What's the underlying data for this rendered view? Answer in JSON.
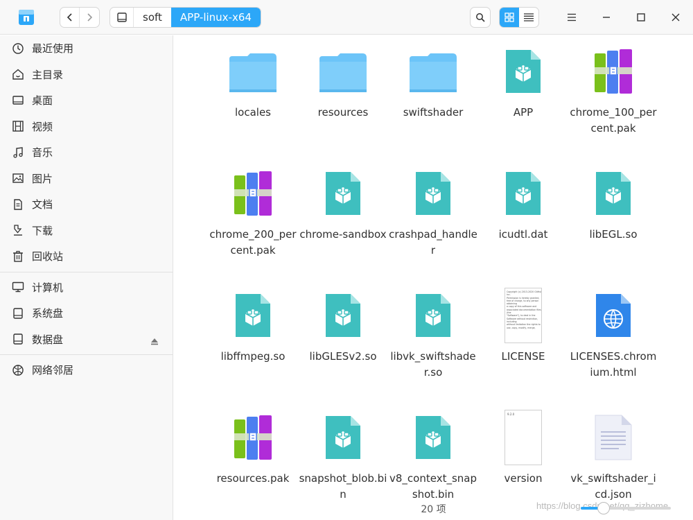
{
  "titlebar": {
    "breadcrumbs": [
      "soft",
      "APP-linux-x64"
    ]
  },
  "sidebar": {
    "groups": [
      [
        {
          "label": "最近使用",
          "icon": "clock-icon"
        },
        {
          "label": "主目录",
          "icon": "home-icon"
        },
        {
          "label": "桌面",
          "icon": "desktop-icon"
        },
        {
          "label": "视频",
          "icon": "video-icon"
        },
        {
          "label": "音乐",
          "icon": "music-icon"
        },
        {
          "label": "图片",
          "icon": "picture-icon"
        },
        {
          "label": "文档",
          "icon": "document-icon"
        },
        {
          "label": "下载",
          "icon": "download-icon"
        },
        {
          "label": "回收站",
          "icon": "trash-icon"
        }
      ],
      [
        {
          "label": "计算机",
          "icon": "computer-icon"
        },
        {
          "label": "系统盘",
          "icon": "drive-icon"
        },
        {
          "label": "数据盘",
          "icon": "drive-icon"
        }
      ],
      [
        {
          "label": "网络邻居",
          "icon": "network-icon"
        }
      ]
    ]
  },
  "files": [
    {
      "name": "locales",
      "type": "folder"
    },
    {
      "name": "resources",
      "type": "folder"
    },
    {
      "name": "swiftshader",
      "type": "folder"
    },
    {
      "name": "APP",
      "type": "binary"
    },
    {
      "name": "chrome_100_percent.pak",
      "type": "archive"
    },
    {
      "name": "chrome_200_percent.pak",
      "type": "archive"
    },
    {
      "name": "chrome-sandbox",
      "type": "binary"
    },
    {
      "name": "crashpad_handler",
      "type": "binary"
    },
    {
      "name": "icudtl.dat",
      "type": "binary"
    },
    {
      "name": "libEGL.so",
      "type": "binary"
    },
    {
      "name": "libffmpeg.so",
      "type": "binary"
    },
    {
      "name": "libGLESv2.so",
      "type": "binary"
    },
    {
      "name": "libvk_swiftshader.so",
      "type": "binary"
    },
    {
      "name": "LICENSE",
      "type": "text-preview"
    },
    {
      "name": "LICENSES.chromium.html",
      "type": "html"
    },
    {
      "name": "resources.pak",
      "type": "archive"
    },
    {
      "name": "snapshot_blob.bin",
      "type": "binary"
    },
    {
      "name": "v8_context_snapshot.bin",
      "type": "binary"
    },
    {
      "name": "version",
      "type": "version-preview"
    },
    {
      "name": "vk_swiftshader_icd.json",
      "type": "json"
    }
  ],
  "license_preview_lines": [
    "Copyright (c) 2013-2020 GitHub",
    "Inc.",
    "",
    "Permission is hereby granted,",
    "free of charge, to any person",
    "obtaining",
    "a copy of this software and",
    "associated documentation files",
    "(the",
    "\"Software\"), to deal in the",
    "Software without restriction,",
    "including",
    "without limitation the rights to",
    "use, copy, modify, merge,"
  ],
  "version_preview_text": "9.2.0",
  "status": {
    "item_count": "20 项"
  },
  "zoom": {
    "level_fraction": 0.25
  },
  "watermark": "https://blog.csdn.net/qq_zizhome",
  "colors": {
    "accent": "#2ca7f8",
    "folder": "#6cc4f8",
    "binary": "#3fbfbf"
  }
}
